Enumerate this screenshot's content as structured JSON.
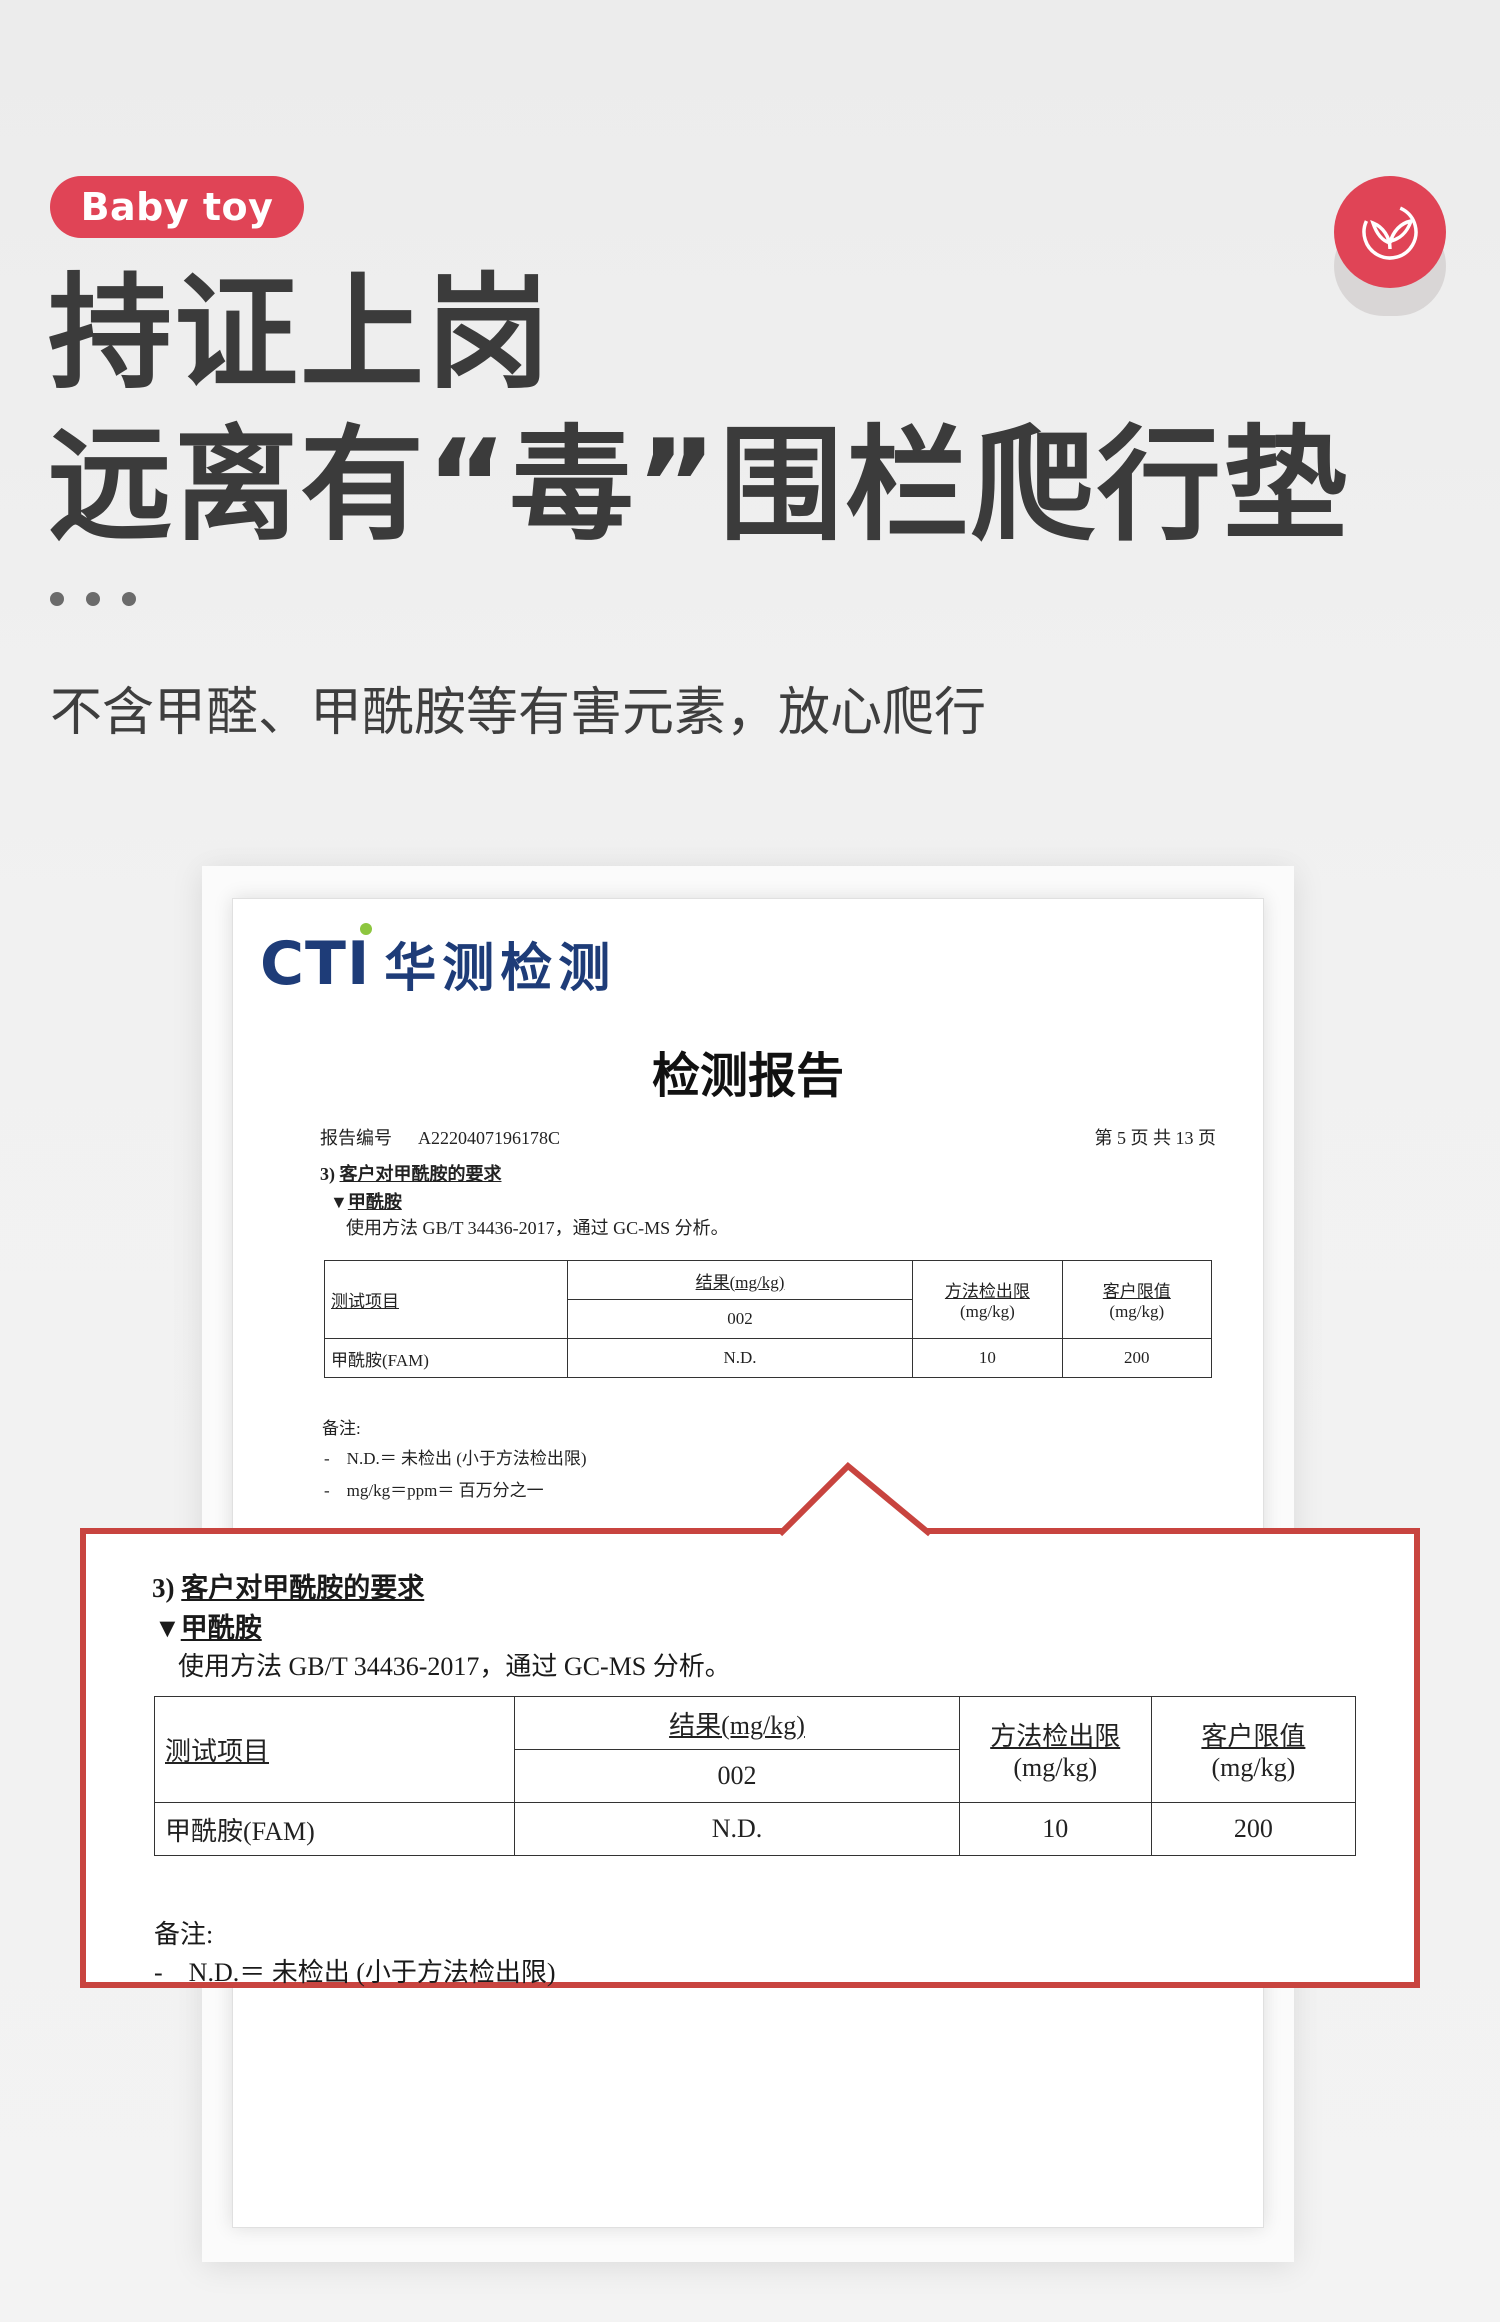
{
  "header": {
    "badge": "Baby toy",
    "headline_line1": "持证上岗",
    "headline_line2": "远离有“毒”围栏爬行垫",
    "subtitle": "不含甲醛、甲酰胺等有害元素，放心爬行",
    "accent_color": "#e04456",
    "corner_icon": "leaf-icon"
  },
  "report": {
    "logo_en": "CTI",
    "logo_cn": "华测检测",
    "title": "检测报告",
    "report_no_label": "报告编号",
    "report_no": "A2220407196178C",
    "page_info": "第 5 页   共 13 页",
    "section": "3)",
    "section_title": "客户对甲酰胺的要求",
    "sub_marker": "▼",
    "sub_title": "甲酰胺",
    "method": "使用方法 GB/T 34436-2017，通过 GC-MS 分析。",
    "table": {
      "col_item": "测试项目",
      "col_result": "结果(mg/kg)",
      "col_result_sample": "002",
      "col_limit": "方法检出限",
      "col_limit_unit": "(mg/kg)",
      "col_client": "客户限值",
      "col_client_unit": "(mg/kg)",
      "row_item": "甲酰胺(FAM)",
      "row_result": "N.D.",
      "row_limit": "10",
      "row_client": "200"
    },
    "notes_label": "备注:",
    "note_marker": "-",
    "note1": "N.D.＝ 未检出 (小于方法检出限)",
    "note2": "mg/kg＝ppm＝ 百万分之一"
  }
}
